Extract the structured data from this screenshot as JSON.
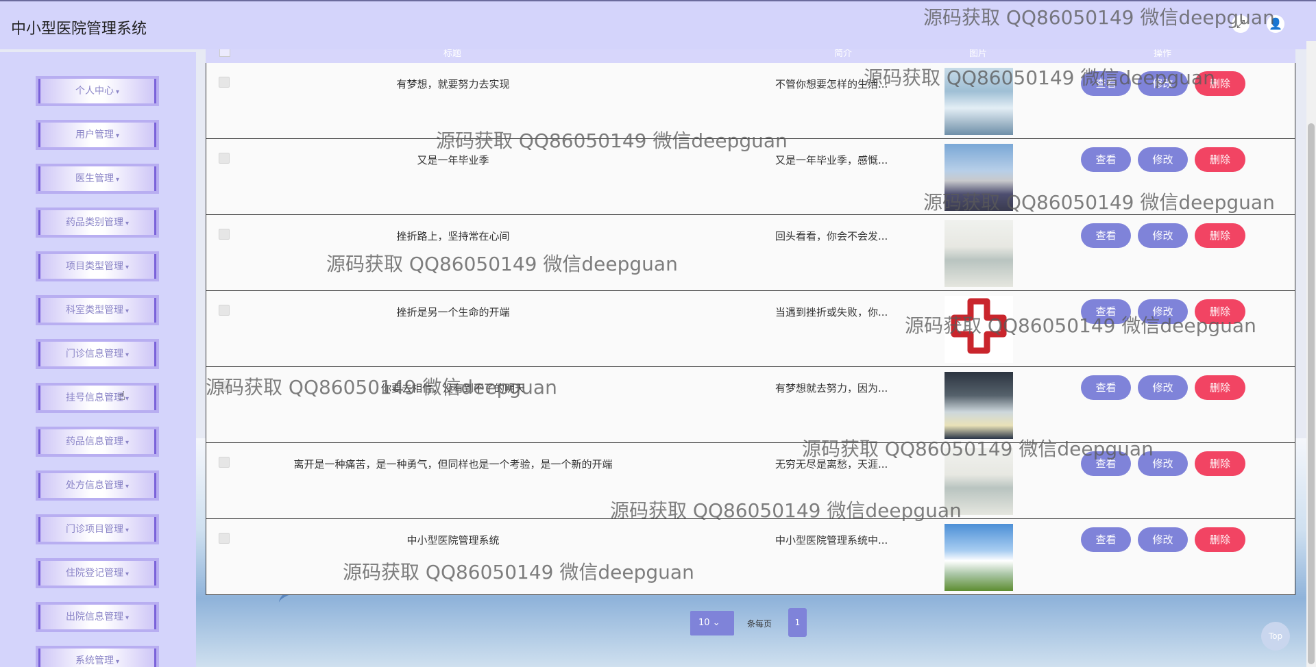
{
  "header": {
    "title": "中小型医院管理系统",
    "icons": [
      "fullscreen-icon",
      "user-icon"
    ]
  },
  "sidebar": {
    "items": [
      {
        "label": "个人中心"
      },
      {
        "label": "用户管理"
      },
      {
        "label": "医生管理"
      },
      {
        "label": "药品类别管理"
      },
      {
        "label": "项目类型管理"
      },
      {
        "label": "科室类型管理"
      },
      {
        "label": "门诊信息管理"
      },
      {
        "label": "挂号信息管理"
      },
      {
        "label": "药品信息管理"
      },
      {
        "label": "处方信息管理"
      },
      {
        "label": "门诊项目管理"
      },
      {
        "label": "住院登记管理"
      },
      {
        "label": "出院信息管理"
      },
      {
        "label": "系统管理"
      }
    ]
  },
  "table": {
    "headers": [
      "标题",
      "简介",
      "图片",
      "操作"
    ],
    "rows": [
      {
        "title": "有梦想，就要努力去实现",
        "intro": "不管你想要怎样的生活...",
        "image": "hospital-icu-photo"
      },
      {
        "title": "又是一年毕业季",
        "intro": "又是一年毕业季，感慨...",
        "image": "hospital-building-photo"
      },
      {
        "title": "挫折路上，坚持常在心间",
        "intro": "回头看看，你会不会发...",
        "image": "hospital-ward-photo"
      },
      {
        "title": "挫折是另一个生命的开端",
        "intro": "当遇到挫折或失败，你...",
        "image": "red-cross-logo"
      },
      {
        "title": "你要去相信，没有到不了的明天",
        "intro": "有梦想就去努力，因为...",
        "image": "hospital-hall-photo"
      },
      {
        "title": "离开是一种痛苦，是一种勇气，但同样也是一个考验，是一个新的开端",
        "intro": "无穷无尽是离愁，天涯...",
        "image": "hospital-ward-photo"
      },
      {
        "title": "中小型医院管理系统",
        "intro": "中小型医院管理系统中...",
        "image": "sky-grassland-photo"
      }
    ],
    "actions": {
      "view": "查看",
      "edit": "修改",
      "delete": "删除"
    }
  },
  "pagination": {
    "page_size": "10",
    "page_size_label": "条每页",
    "current_page": "1"
  },
  "top_button": "Top",
  "watermark": "源码获取 QQ86050149 微信deepguan",
  "colors": {
    "primary": "#7f83d9",
    "danger": "#f24463",
    "header_bg": "#d4d4fb"
  }
}
